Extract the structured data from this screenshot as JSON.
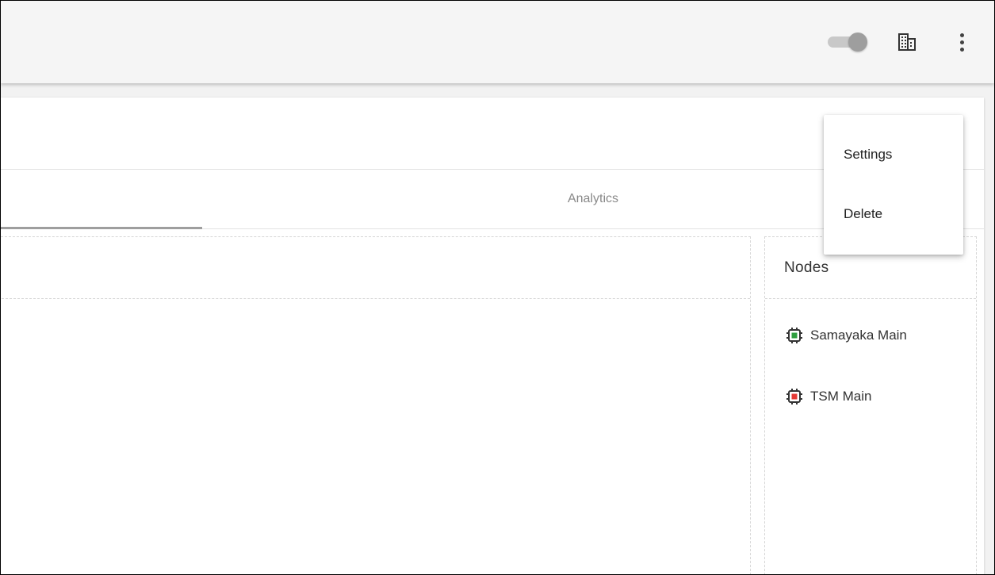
{
  "toolbar": {
    "toggle_state": "on",
    "icons": [
      "toggle-switch",
      "building-icon",
      "more-vert-icon"
    ]
  },
  "tabs": [
    {
      "label": "",
      "active": true
    },
    {
      "label": "Analytics",
      "active": false
    }
  ],
  "nodes_panel": {
    "title": "Nodes",
    "items": [
      {
        "label": "Samayaka Main",
        "status": "online",
        "status_color": "#2e9e3f",
        "icon": "chip-icon"
      },
      {
        "label": "TSM Main",
        "status": "offline",
        "status_color": "#e53935",
        "icon": "chip-icon"
      }
    ]
  },
  "menu": {
    "items": [
      {
        "label": "Settings"
      },
      {
        "label": "Delete"
      }
    ]
  },
  "colors": {
    "toolbar_bg": "#f5f5f5",
    "tab_indicator": "#9e9e9e",
    "text": "#333333"
  }
}
